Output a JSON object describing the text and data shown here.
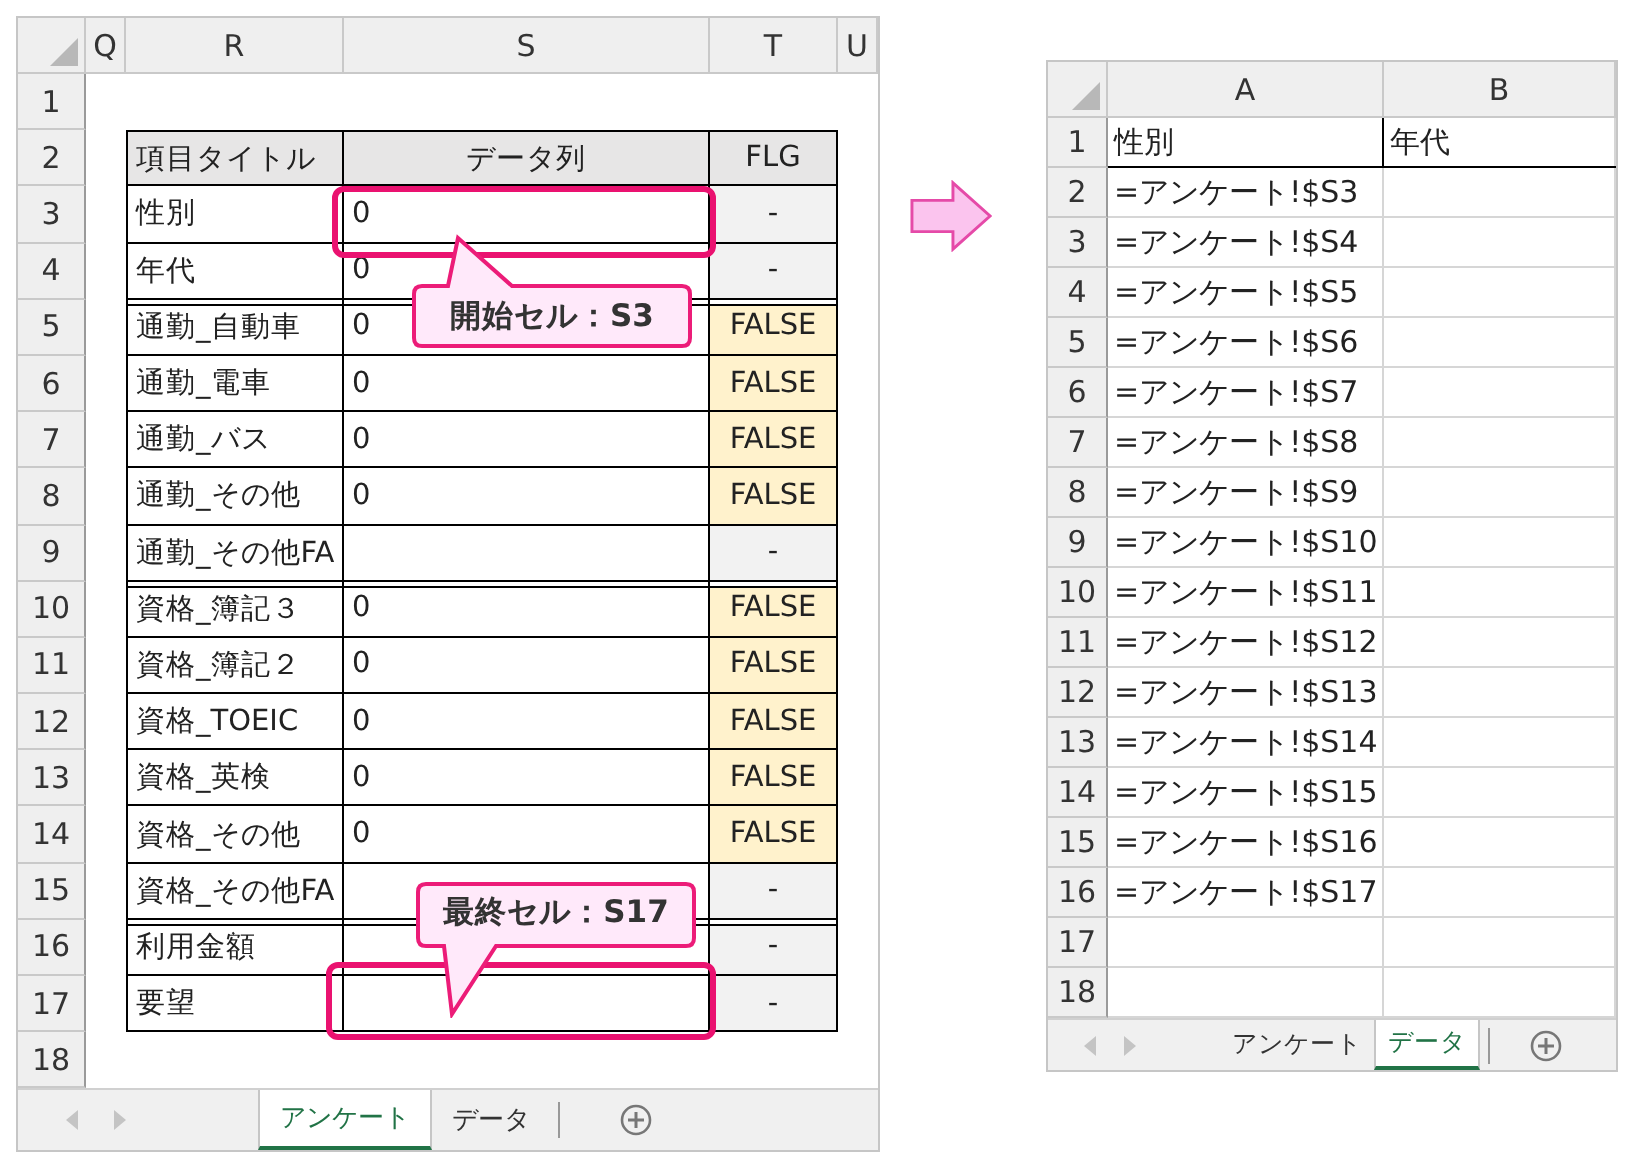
{
  "left_sheet": {
    "columns": [
      "Q",
      "R",
      "S",
      "T",
      "U"
    ],
    "row_numbers": [
      "1",
      "2",
      "3",
      "4",
      "5",
      "6",
      "7",
      "8",
      "9",
      "10",
      "11",
      "12",
      "13",
      "14",
      "15",
      "16",
      "17",
      "18"
    ],
    "table": {
      "header": [
        "項目タイトル",
        "データ列",
        "FLG"
      ],
      "rows": [
        {
          "title": "性別",
          "value": "0",
          "flg": "-",
          "flg_filled": false,
          "group_start": false
        },
        {
          "title": "年代",
          "value": "0",
          "flg": "-",
          "flg_filled": false,
          "group_start": false
        },
        {
          "title": "通勤_自動車",
          "value": "0",
          "flg": "FALSE",
          "flg_filled": true,
          "group_start": true
        },
        {
          "title": "通勤_電車",
          "value": "0",
          "flg": "FALSE",
          "flg_filled": true,
          "group_start": false
        },
        {
          "title": "通勤_バス",
          "value": "0",
          "flg": "FALSE",
          "flg_filled": true,
          "group_start": false
        },
        {
          "title": "通勤_その他",
          "value": "0",
          "flg": "FALSE",
          "flg_filled": true,
          "group_start": false
        },
        {
          "title": "通勤_その他FA",
          "flg": "-",
          "flg_filled": false,
          "group_start": false
        },
        {
          "title": "資格_簿記３",
          "value": "0",
          "flg": "FALSE",
          "flg_filled": true,
          "group_start": true
        },
        {
          "title": "資格_簿記２",
          "value": "0",
          "flg": "FALSE",
          "flg_filled": true,
          "group_start": false
        },
        {
          "title": "資格_TOEIC",
          "value": "0",
          "flg": "FALSE",
          "flg_filled": true,
          "group_start": false
        },
        {
          "title": "資格_英検",
          "value": "0",
          "flg": "FALSE",
          "flg_filled": true,
          "group_start": false
        },
        {
          "title": "資格_その他",
          "value": "0",
          "flg": "FALSE",
          "flg_filled": true,
          "group_start": false
        },
        {
          "title": "資格_その他FA",
          "flg": "-",
          "flg_filled": false,
          "group_start": false
        },
        {
          "title": "利用金額",
          "flg": "-",
          "flg_filled": false,
          "group_start": true
        },
        {
          "title": "要望",
          "flg": "-",
          "flg_filled": false,
          "group_start": false
        }
      ]
    },
    "callouts": [
      {
        "text": "開始セル：S3"
      },
      {
        "text": "最終セル：S17"
      }
    ],
    "sheet_tabs": [
      {
        "label": "アンケート",
        "selected": true
      },
      {
        "label": "データ",
        "selected": false
      }
    ]
  },
  "right_sheet": {
    "columns": [
      "A",
      "B"
    ],
    "rows": [
      {
        "number": "1",
        "kind": "header",
        "cells": [
          "性別",
          "年代"
        ]
      },
      {
        "number": "2",
        "kind": "formula",
        "cells": [
          "=アンケート!$S3"
        ]
      },
      {
        "number": "3",
        "kind": "formula",
        "cells": [
          "=アンケート!$S4"
        ]
      },
      {
        "number": "4",
        "kind": "formula",
        "cells": [
          "=アンケート!$S5"
        ]
      },
      {
        "number": "5",
        "kind": "formula",
        "cells": [
          "=アンケート!$S6"
        ]
      },
      {
        "number": "6",
        "kind": "formula",
        "cells": [
          "=アンケート!$S7"
        ]
      },
      {
        "number": "7",
        "kind": "formula",
        "cells": [
          "=アンケート!$S8"
        ]
      },
      {
        "number": "8",
        "kind": "formula",
        "cells": [
          "=アンケート!$S9"
        ]
      },
      {
        "number": "9",
        "kind": "formula",
        "cells": [
          "=アンケート!$S10"
        ]
      },
      {
        "number": "10",
        "kind": "formula",
        "cells": [
          "=アンケート!$S11"
        ]
      },
      {
        "number": "11",
        "kind": "formula",
        "cells": [
          "=アンケート!$S12"
        ]
      },
      {
        "number": "12",
        "kind": "formula",
        "cells": [
          "=アンケート!$S13"
        ]
      },
      {
        "number": "13",
        "kind": "formula",
        "cells": [
          "=アンケート!$S14"
        ]
      },
      {
        "number": "14",
        "kind": "formula",
        "cells": [
          "=アンケート!$S15"
        ]
      },
      {
        "number": "15",
        "kind": "formula",
        "cells": [
          "=アンケート!$S16"
        ]
      },
      {
        "number": "16",
        "kind": "formula",
        "cells": [
          "=アンケート!$S17"
        ]
      },
      {
        "number": "17",
        "kind": "formula"
      },
      {
        "number": "18",
        "kind": "formula"
      }
    ],
    "sheet_tabs": [
      {
        "label": "アンケート",
        "selected": false
      },
      {
        "label": "データ",
        "selected": true
      }
    ]
  }
}
